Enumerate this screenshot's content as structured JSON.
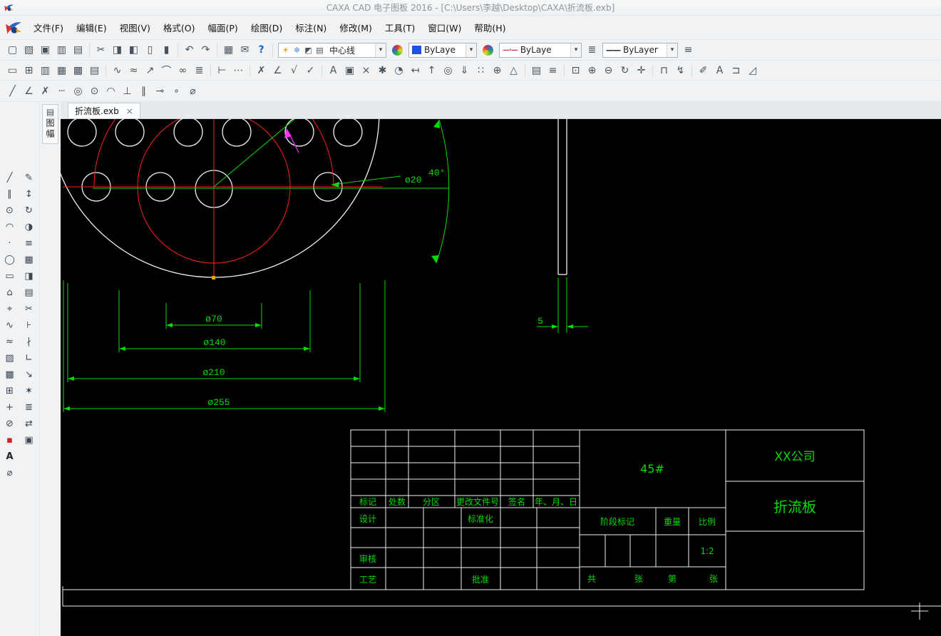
{
  "window": {
    "title": "CAXA CAD 电子图板 2016 - [C:\\Users\\李越\\Desktop\\CAXA\\折流板.exb]"
  },
  "ui": {
    "dropdown_arrow": "▾",
    "linetype_swatch": "—·—",
    "linewidth_swatch": "——"
  },
  "menu": {
    "items": [
      {
        "name": "menu-file",
        "label": "文件(F)"
      },
      {
        "name": "menu-edit",
        "label": "编辑(E)"
      },
      {
        "name": "menu-view",
        "label": "视图(V)"
      },
      {
        "name": "menu-format",
        "label": "格式(O)"
      },
      {
        "name": "menu-paper",
        "label": "幅面(P)"
      },
      {
        "name": "menu-draw",
        "label": "绘图(D)"
      },
      {
        "name": "menu-dimension",
        "label": "标注(N)"
      },
      {
        "name": "menu-modify",
        "label": "修改(M)"
      },
      {
        "name": "menu-tools",
        "label": "工具(T)"
      },
      {
        "name": "menu-window",
        "label": "窗口(W)"
      },
      {
        "name": "menu-help",
        "label": "帮助(H)"
      }
    ]
  },
  "toolbar1": {
    "group_file": [
      {
        "name": "new-file-icon",
        "glyph": "▢"
      },
      {
        "name": "open-file-icon",
        "glyph": "▧"
      },
      {
        "name": "save-icon",
        "glyph": "▣"
      },
      {
        "name": "print-preview-icon",
        "glyph": "▥"
      },
      {
        "name": "print-icon",
        "glyph": "▤"
      }
    ],
    "group_clipboard": [
      {
        "name": "cut-icon",
        "glyph": "✂"
      },
      {
        "name": "copy-icon",
        "glyph": "◨"
      },
      {
        "name": "copy-with-basepoint-icon",
        "glyph": "◧"
      },
      {
        "name": "paste-icon",
        "glyph": "▯"
      },
      {
        "name": "paste-special-icon",
        "glyph": "▮"
      }
    ],
    "group_undo": [
      {
        "name": "undo-icon",
        "glyph": "↶"
      },
      {
        "name": "redo-icon",
        "glyph": "↷"
      }
    ],
    "group_misc": [
      {
        "name": "insert-frame-icon",
        "glyph": "▦"
      },
      {
        "name": "ole-object-icon",
        "glyph": "✉"
      },
      {
        "name": "help-icon",
        "glyph": "?",
        "style_css": "color:#1c62c8;font-weight:bold"
      }
    ],
    "layer_tools": [
      {
        "name": "layer-visibility-icon",
        "glyph": "☀",
        "style_css": "color:#d89a00"
      },
      {
        "name": "layer-freeze-icon",
        "glyph": "❄",
        "style_css": "color:#4a90d8"
      },
      {
        "name": "layer-lock-icon",
        "glyph": "◩"
      },
      {
        "name": "layer-settings-icon",
        "glyph": "▤"
      }
    ],
    "layer_combo_value": "中心线",
    "color_combo_value": "ByLaye",
    "linetype_combo_value": "ByLaye",
    "linewidth_combo_value": "ByLayer",
    "end_icon": {
      "name": "toolbar-options-icon",
      "glyph": "≡"
    }
  },
  "toolbar2": {
    "group_views": [
      {
        "name": "new-sheet-icon",
        "glyph": "▭"
      },
      {
        "name": "standard-views-icon",
        "glyph": "⊞"
      },
      {
        "name": "section-view-icon",
        "glyph": "▥"
      },
      {
        "name": "projection-view-icon",
        "glyph": "▦"
      },
      {
        "name": "partial-view-icon",
        "glyph": "▩"
      },
      {
        "name": "table-icon",
        "glyph": "▤"
      }
    ],
    "group_curves": [
      {
        "name": "spline-icon",
        "glyph": "∿"
      },
      {
        "name": "wave-line-icon",
        "glyph": "≈"
      },
      {
        "name": "leader-icon",
        "glyph": "↗"
      },
      {
        "name": "arc-tool-icon",
        "glyph": "⌒"
      },
      {
        "name": "link-icon",
        "glyph": "∞"
      },
      {
        "name": "list-icon",
        "glyph": "≣"
      }
    ],
    "group_dims": [
      {
        "name": "dim-linear-icon",
        "glyph": "⊢"
      },
      {
        "name": "dim-continuous-icon",
        "glyph": "⋯"
      }
    ],
    "group_marks": [
      {
        "name": "erase-icon",
        "glyph": "✗"
      },
      {
        "name": "dim-angle-icon",
        "glyph": "∠"
      },
      {
        "name": "dim-radius-icon",
        "glyph": "√"
      },
      {
        "name": "check-icon",
        "glyph": "✓"
      }
    ],
    "group_annotate": [
      {
        "name": "text-icon",
        "glyph": "A"
      },
      {
        "name": "image-icon",
        "glyph": "▣"
      },
      {
        "name": "explode-icon",
        "glyph": "×"
      },
      {
        "name": "settings-icon",
        "glyph": "✱"
      },
      {
        "name": "history-icon",
        "glyph": "◔"
      },
      {
        "name": "align-left-icon",
        "glyph": "↤"
      },
      {
        "name": "move-up-icon",
        "glyph": "↑"
      },
      {
        "name": "target-icon",
        "glyph": "◎"
      },
      {
        "name": "download-icon",
        "glyph": "⇓"
      },
      {
        "name": "pattern-icon",
        "glyph": "∷"
      },
      {
        "name": "insert-plus-icon",
        "glyph": "⊕"
      },
      {
        "name": "library-icon",
        "glyph": "△"
      }
    ],
    "group_sheet": [
      {
        "name": "sheet-settings-icon",
        "glyph": "▤"
      },
      {
        "name": "layout-icon",
        "glyph": "≡"
      }
    ],
    "group_zoom": [
      {
        "name": "zoom-window-icon",
        "glyph": "⊡"
      },
      {
        "name": "zoom-in-icon",
        "glyph": "⊕"
      },
      {
        "name": "zoom-out-icon",
        "glyph": "⊖"
      },
      {
        "name": "zoom-extents-icon",
        "glyph": "↻"
      },
      {
        "name": "pan-icon",
        "glyph": "✛"
      }
    ],
    "group_window": [
      {
        "name": "window-select-icon",
        "glyph": "⊓"
      },
      {
        "name": "quick-pick-icon",
        "glyph": "↯"
      }
    ],
    "group_styles": [
      {
        "name": "brush-style-icon",
        "glyph": "✐"
      },
      {
        "name": "text-style-icon",
        "glyph": "A"
      },
      {
        "name": "dim-style-icon",
        "glyph": "⊐"
      },
      {
        "name": "ruler-icon",
        "glyph": "◿"
      }
    ]
  },
  "toolbar3": {
    "icons": [
      {
        "name": "line-icon",
        "glyph": "╱"
      },
      {
        "name": "angular-line-icon",
        "glyph": "∠"
      },
      {
        "name": "cross-erase-icon",
        "glyph": "✗"
      },
      {
        "name": "axis-line-icon",
        "glyph": "┄"
      },
      {
        "name": "concentric-circles-icon",
        "glyph": "◎"
      },
      {
        "name": "circle-icon",
        "glyph": "⊙"
      },
      {
        "name": "arc-icon",
        "glyph": "◠"
      },
      {
        "name": "perpendicular-icon",
        "glyph": "⊥"
      },
      {
        "name": "parallel-icon",
        "glyph": "∥"
      },
      {
        "name": "tangent-icon",
        "glyph": "⊸"
      },
      {
        "name": "point-icon",
        "glyph": "∘"
      },
      {
        "name": "measure-icon",
        "glyph": "⌀"
      }
    ]
  },
  "sidebar": {
    "col1": [
      {
        "name": "draw-line-icon",
        "glyph": "╱"
      },
      {
        "name": "draw-parallel-icon",
        "glyph": "∥"
      },
      {
        "name": "draw-circle-icon",
        "glyph": "⊙"
      },
      {
        "name": "draw-arc-icon",
        "glyph": "◠"
      },
      {
        "name": "draw-point-icon",
        "glyph": "·"
      },
      {
        "name": "draw-ellipse-icon",
        "glyph": "◯"
      },
      {
        "name": "draw-rectangle-icon",
        "glyph": "▭"
      },
      {
        "name": "draw-polygon-icon",
        "glyph": "⌂"
      },
      {
        "name": "draw-centerline-icon",
        "glyph": "⌖"
      },
      {
        "name": "draw-spline-icon",
        "glyph": "∿"
      },
      {
        "name": "draw-contour-icon",
        "glyph": "≈"
      },
      {
        "name": "hatch-icon",
        "glyph": "▨"
      },
      {
        "name": "region-fill-icon",
        "glyph": "▩"
      },
      {
        "name": "block-icon",
        "glyph": "⊞"
      },
      {
        "name": "crosshair-icon",
        "glyph": "+"
      },
      {
        "name": "hole-icon",
        "glyph": "⊘"
      },
      {
        "name": "fill-color-icon",
        "glyph": "▪",
        "style_css": "color:#cc2222"
      },
      {
        "name": "text-tool-icon",
        "glyph": "A",
        "style_css": "color:#20262c;font-weight:bold"
      },
      {
        "name": "formula-icon",
        "glyph": "⌀"
      }
    ],
    "col2": [
      {
        "name": "pen-edit-icon",
        "glyph": "✎"
      },
      {
        "name": "move-icon",
        "glyph": "↕"
      },
      {
        "name": "rotate-icon",
        "glyph": "↻"
      },
      {
        "name": "mirror-icon",
        "glyph": "◑"
      },
      {
        "name": "offset-icon",
        "glyph": "≡"
      },
      {
        "name": "array-icon",
        "glyph": "▦"
      },
      {
        "name": "copy-entity-icon",
        "glyph": "◨"
      },
      {
        "name": "grid-icon",
        "glyph": "▤"
      },
      {
        "name": "trim-icon",
        "glyph": "✂"
      },
      {
        "name": "extend-icon",
        "glyph": "⊦"
      },
      {
        "name": "break-icon",
        "glyph": "∤"
      },
      {
        "name": "corner-icon",
        "glyph": "∟"
      },
      {
        "name": "stretch-icon",
        "glyph": "↘"
      },
      {
        "name": "explode-entity-icon",
        "glyph": "✶"
      },
      {
        "name": "properties-icon",
        "glyph": "≣"
      },
      {
        "name": "swap-icon",
        "glyph": "⇄"
      },
      {
        "name": "stamp-icon",
        "glyph": "▣"
      }
    ]
  },
  "sheet_panel": {
    "icon_glyph": "▤",
    "label": "图幅"
  },
  "tab": {
    "label": "折流板.exb",
    "close_glyph": "×"
  },
  "drawing": {
    "dims": {
      "hole": "ø20",
      "angle": "40°",
      "d70": "ø70",
      "d140": "ø140",
      "d210": "ø210",
      "d255": "ø255",
      "thickness": "5"
    }
  },
  "title_block": {
    "col_headers": [
      "标记",
      "处数",
      "分区",
      "更改文件号",
      "签名",
      "年、月、日"
    ],
    "design": "设计",
    "standardization": "标准化",
    "review": "审核",
    "process": "工艺",
    "approve": "批准",
    "material": "45#",
    "stage_mark": "阶段标记",
    "weight": "重量",
    "scale_label": "比例",
    "scale_value": "1:2",
    "total_label": "共",
    "sheets_label": "张",
    "page_label": "第",
    "page2_label": "张",
    "company": "XX公司",
    "part_name": "折流板"
  }
}
